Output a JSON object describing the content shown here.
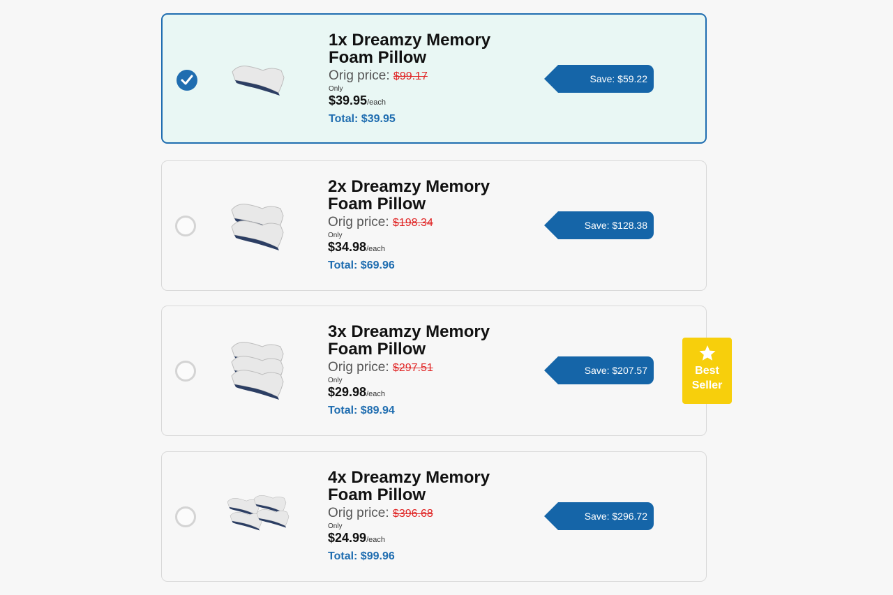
{
  "offers": [
    {
      "title_line1": "1x Dreamzy Memory",
      "title_line2": "Foam Pillow",
      "orig_label": "Orig price:",
      "orig_price": "$99.17",
      "only": "Only",
      "price": "$39.95",
      "each": "/each",
      "total": "Total: $39.95",
      "save": "Save: $59.22",
      "selected": true
    },
    {
      "title_line1": "2x Dreamzy Memory",
      "title_line2": "Foam Pillow",
      "orig_label": "Orig price:",
      "orig_price": "$198.34",
      "only": "Only",
      "price": "$34.98",
      "each": "/each",
      "total": "Total: $69.96",
      "save": "Save: $128.38",
      "selected": false
    },
    {
      "title_line1": "3x Dreamzy Memory",
      "title_line2": "Foam Pillow",
      "orig_label": "Orig price:",
      "orig_price": "$297.51",
      "only": "Only",
      "price": "$29.98",
      "each": "/each",
      "total": "Total: $89.94",
      "save": "Save: $207.57",
      "selected": false
    },
    {
      "title_line1": "4x Dreamzy Memory",
      "title_line2": "Foam Pillow",
      "orig_label": "Orig price:",
      "orig_price": "$396.68",
      "only": "Only",
      "price": "$24.99",
      "each": "/each",
      "total": "Total: $99.96",
      "save": "Save: $296.72",
      "selected": false
    }
  ],
  "badge": {
    "icon": "star-icon",
    "line1": "Best",
    "line2": "Seller",
    "color": "#f7cf0c"
  },
  "colors": {
    "accent": "#1f6db0",
    "strike": "#e02424",
    "selected_bg": "#e9f7f4"
  }
}
